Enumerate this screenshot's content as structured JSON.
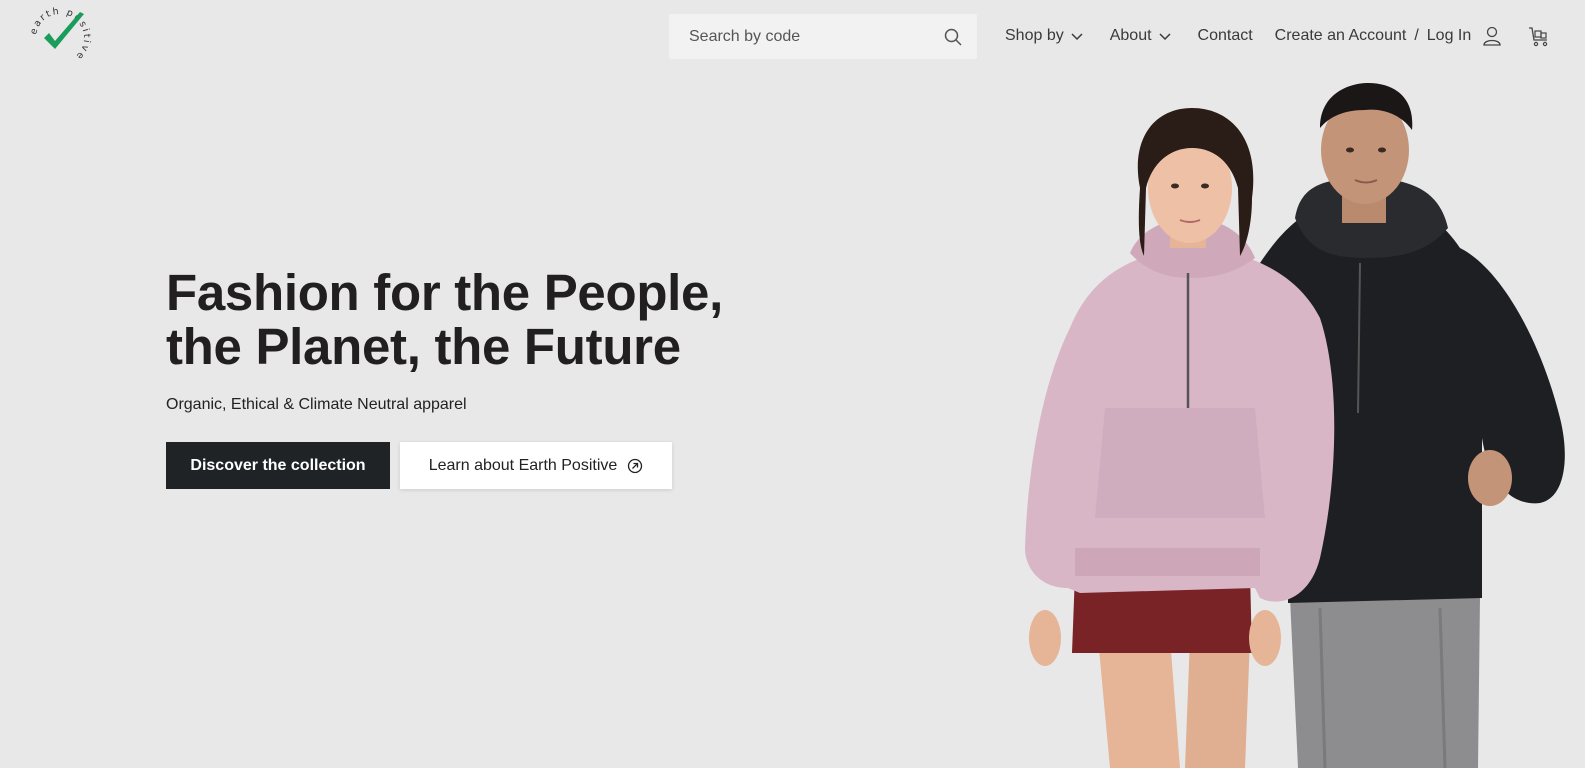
{
  "brand": {
    "logo_text": "earth positive",
    "logo_icon": "checkmark-logo",
    "accent_color": "#1a9c5b"
  },
  "header": {
    "search_placeholder": "Search by code",
    "nav": {
      "shop_by": "Shop by",
      "about": "About",
      "contact": "Contact",
      "create_account": "Create an Account",
      "separator": "/",
      "login": "Log In"
    },
    "icons": [
      "search-icon",
      "chevron-down-icon",
      "user-icon",
      "cart-icon"
    ]
  },
  "hero": {
    "title_line1": "Fashion for the People,",
    "title_line2": "the Planet, the Future",
    "subtitle": "Organic, Ethical & Climate Neutral apparel",
    "primary_cta": "Discover the collection",
    "secondary_cta": "Learn about Earth Positive"
  },
  "colors": {
    "background": "#e8e8e8",
    "primary_button": "#1f2326",
    "hoodie_pink": "#d8b6c6",
    "hoodie_black": "#1e1f22",
    "skirt": "#7a2326"
  }
}
